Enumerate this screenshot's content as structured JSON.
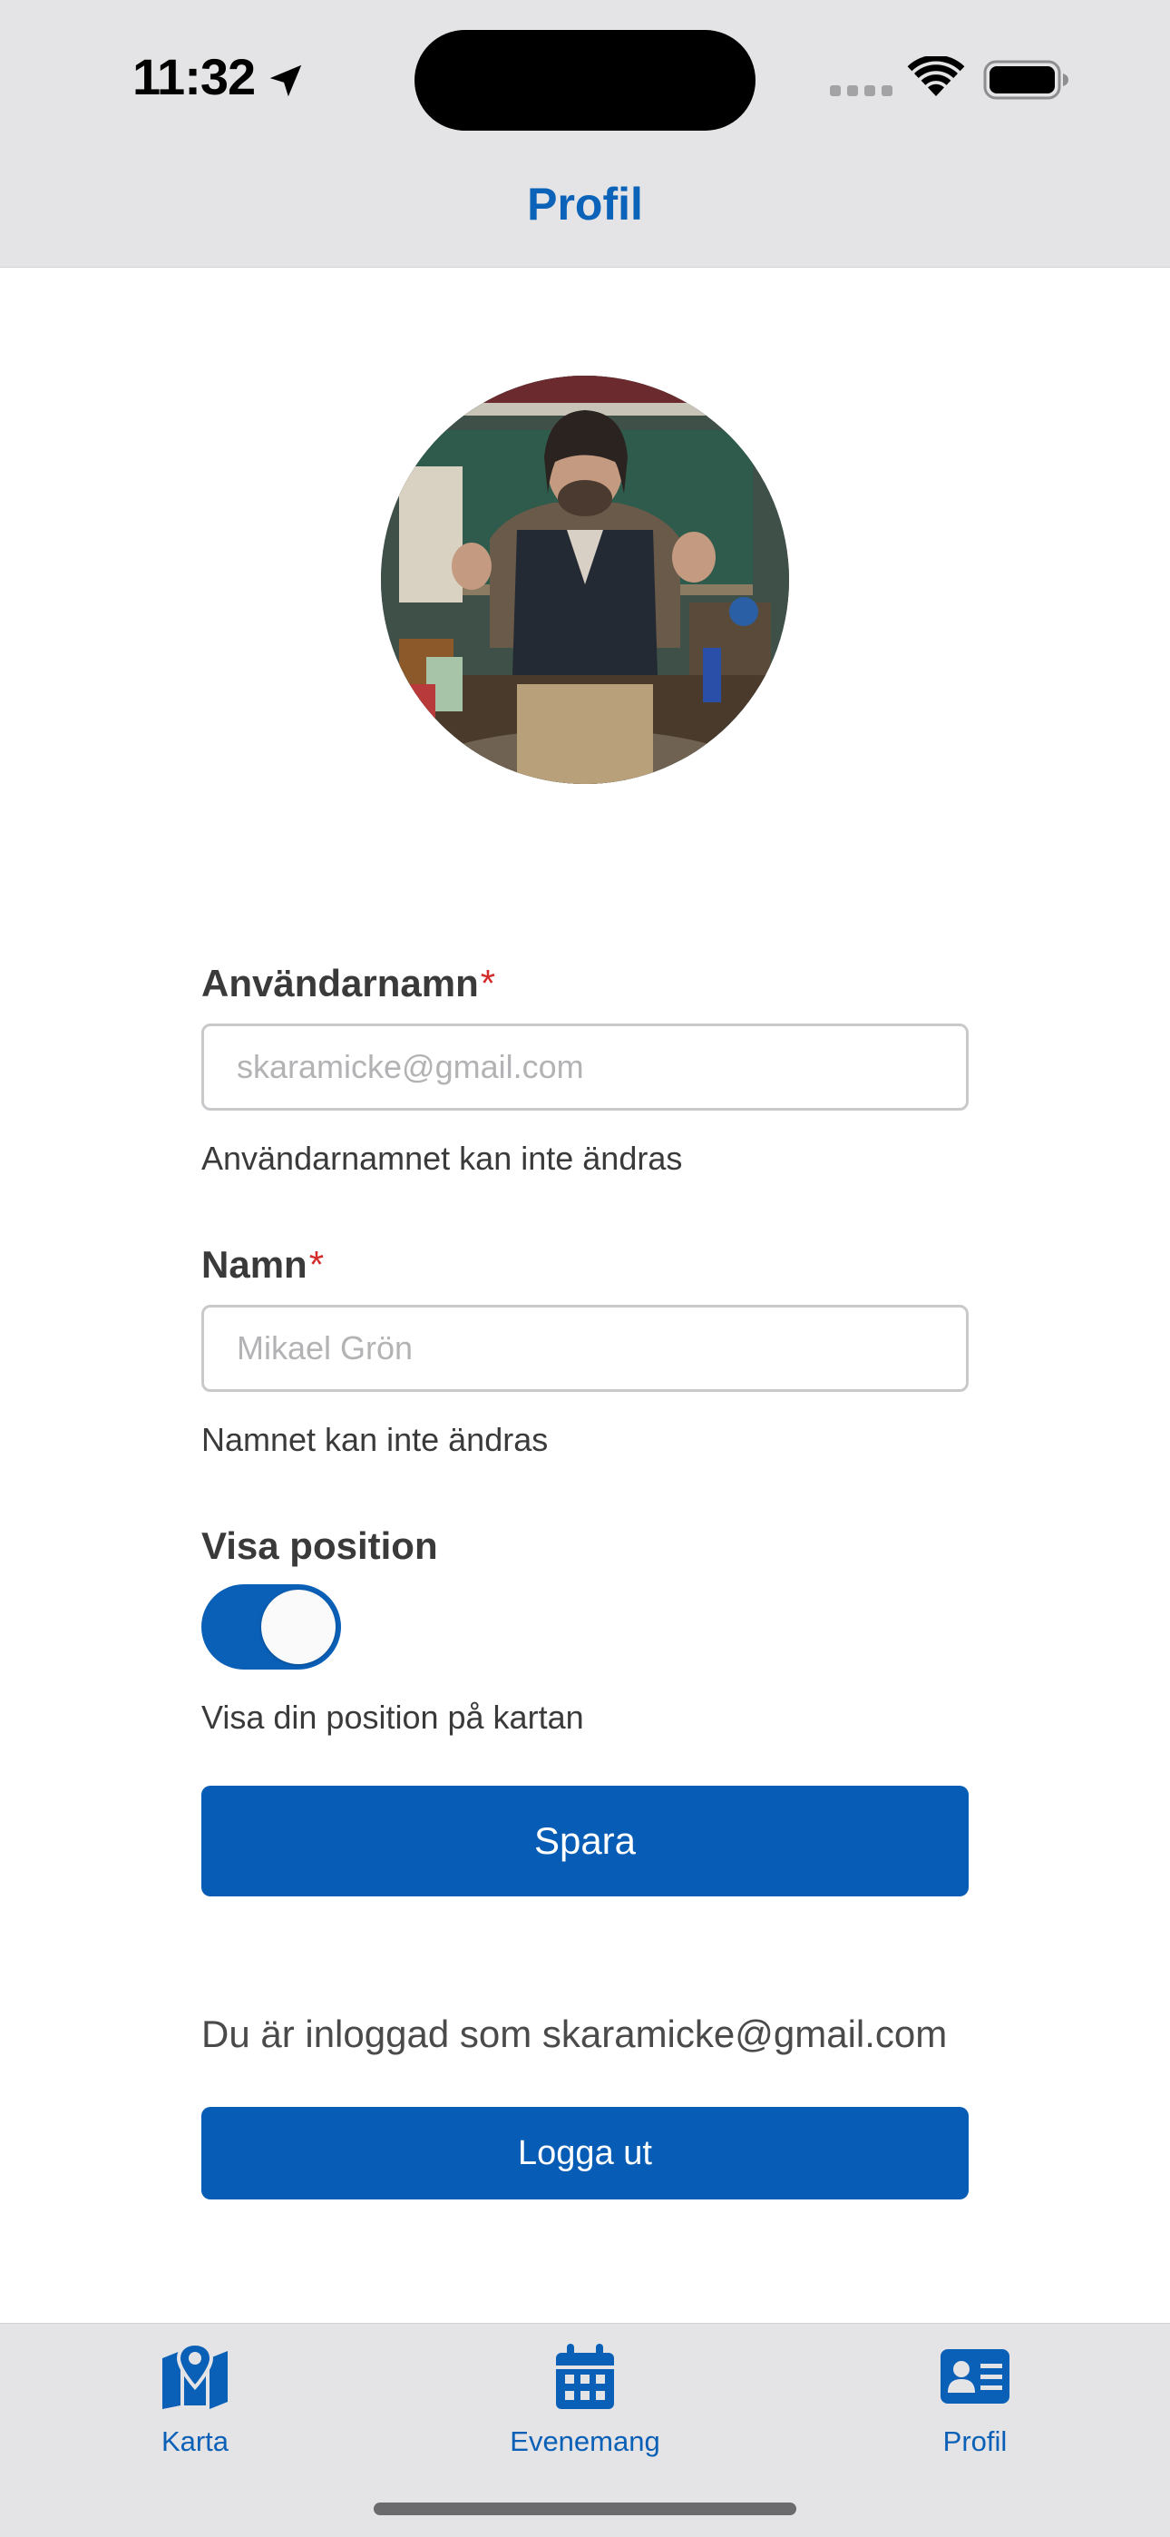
{
  "status_bar": {
    "time": "11:32"
  },
  "header": {
    "title": "Profil"
  },
  "form": {
    "username": {
      "label": "Användarnamn",
      "required_mark": "*",
      "placeholder": "skaramicke@gmail.com",
      "helper": "Användarnamnet kan inte ändras"
    },
    "name": {
      "label": "Namn",
      "required_mark": "*",
      "placeholder": "Mikael Grön",
      "helper": "Namnet kan inte ändras"
    },
    "show_position": {
      "label": "Visa position",
      "enabled": true,
      "helper": "Visa din position på kartan"
    },
    "save_label": "Spara"
  },
  "account": {
    "logged_in_text": "Du är inloggad som skaramicke@gmail.com",
    "logout_label": "Logga ut"
  },
  "tabbar": {
    "items": [
      {
        "label": "Karta",
        "icon": "map-icon"
      },
      {
        "label": "Evenemang",
        "icon": "calendar-icon"
      },
      {
        "label": "Profil",
        "icon": "profile-card-icon",
        "active": true
      }
    ]
  },
  "colors": {
    "accent": "#0a5fb6",
    "required": "#d62b2b",
    "bar_background": "#e4e4e6"
  }
}
